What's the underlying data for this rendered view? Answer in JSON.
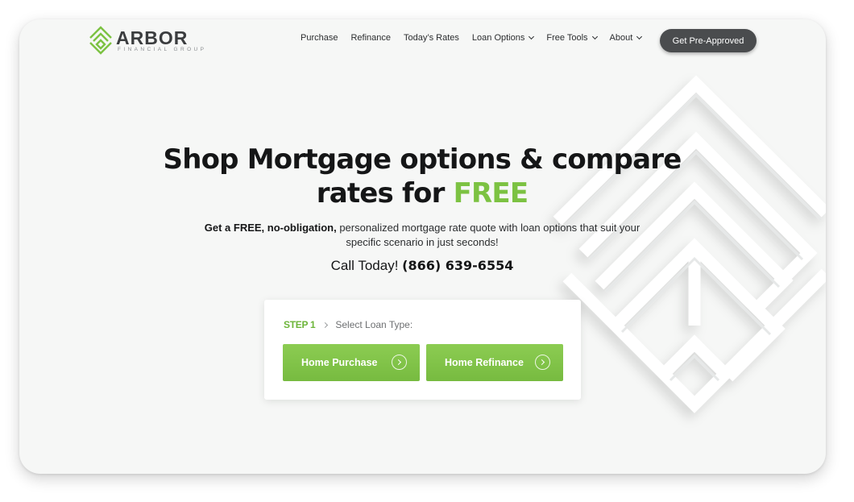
{
  "brand": {
    "name": "ARBOR",
    "tagline": "FINANCIAL GROUP",
    "accent_color": "#7cc242",
    "dark_color": "#3b3d3f"
  },
  "nav": {
    "items": [
      {
        "label": "Purchase",
        "has_dropdown": false
      },
      {
        "label": "Refinance",
        "has_dropdown": false
      },
      {
        "label": "Today’s Rates",
        "has_dropdown": false
      },
      {
        "label": "Loan Options",
        "has_dropdown": true
      },
      {
        "label": "Free Tools",
        "has_dropdown": true
      },
      {
        "label": "About",
        "has_dropdown": true
      }
    ],
    "cta_label": "Get Pre-Approved"
  },
  "hero": {
    "headline_line1": "Shop Mortgage options & compare",
    "headline_line2_prefix": "rates for ",
    "headline_highlight": "FREE",
    "sub_bold": "Get a FREE, no-obligation,",
    "sub_rest_line1": " personalized mortgage rate quote with loan options that suit your",
    "sub_line2": "specific scenario in just seconds!",
    "call_prefix": "Call Today! ",
    "phone": "(866) 639-6554"
  },
  "form": {
    "step_label": "STEP 1",
    "step_title": "Select Loan Type:",
    "options": [
      {
        "label": "Home Purchase",
        "icon": "chevron-right-circle-icon"
      },
      {
        "label": "Home Refinance",
        "icon": "chevron-right-circle-icon"
      }
    ]
  }
}
